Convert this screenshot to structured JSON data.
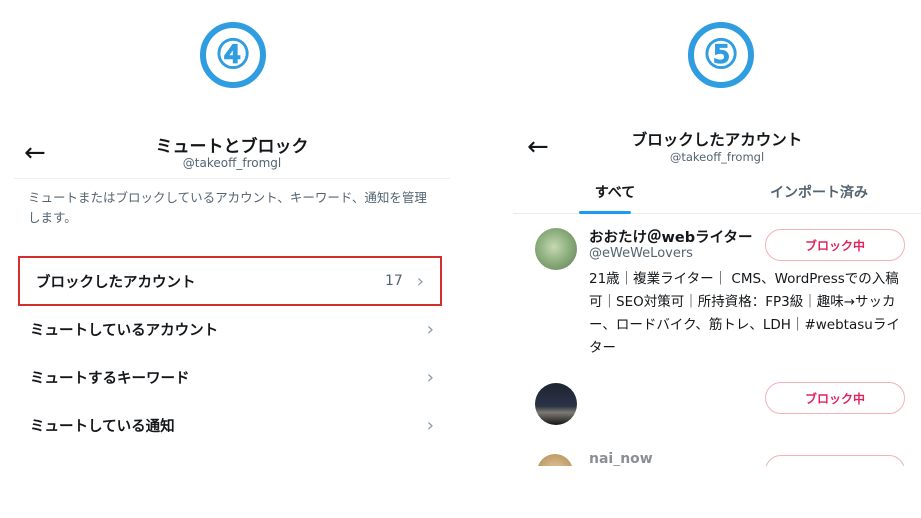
{
  "steps": {
    "left": "④",
    "right": "⑤"
  },
  "left_screen": {
    "back_icon": "←",
    "title": "ミュートとブロック",
    "handle": "@takeoff_fromgl",
    "description": "ミュートまたはブロックしているアカウント、キーワード、通知を管理します。",
    "menu": [
      {
        "label": "ブロックしたアカウント",
        "count": "17",
        "highlight_color": "#d32f2f"
      },
      {
        "label": "ミュートしているアカウント"
      },
      {
        "label": "ミュートするキーワード"
      },
      {
        "label": "ミュートしている通知"
      }
    ],
    "chevron_icon": "›"
  },
  "right_screen": {
    "back_icon": "←",
    "title": "ブロックしたアカウント",
    "handle": "@takeoff_fromgl",
    "tabs": [
      {
        "label": "すべて",
        "active": true
      },
      {
        "label": "インポート済み",
        "active": false
      }
    ],
    "accounts": [
      {
        "name": "おおたけ＠webライター",
        "handle": "@eWeWeLovers",
        "bio": "21歳｜複業ライター｜ CMS、WordPressでの入稿可｜SEO対策可｜所持資格：FP3級｜趣味→サッカー、ロードバイク、筋トレ、LDH｜#webtasuライター",
        "button": "ブロック中"
      },
      {
        "name": "",
        "handle": "",
        "button": "ブロック中"
      },
      {
        "name": "nai_now",
        "button": ""
      }
    ]
  },
  "colors": {
    "accent": "#1d9bf0",
    "step_circle": "#2f9de0",
    "highlight": "#d32f2f",
    "blocked_text": "#e0245e"
  }
}
